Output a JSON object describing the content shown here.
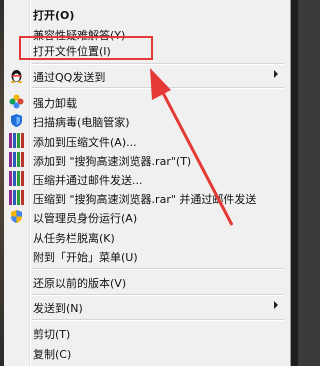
{
  "menu": {
    "items": [
      {
        "label": "打开(O)",
        "bold": true
      },
      {
        "label": "兼容性疑难解答(Y)"
      },
      {
        "label": "打开文件位置(I)"
      },
      {
        "label": "通过QQ发送到",
        "submenu": true,
        "icon": "qq-penguin-icon"
      },
      {
        "label": "强力卸载",
        "icon": "pinwheel-icon"
      },
      {
        "label": "扫描病毒(电脑管家)",
        "icon": "shield-icon"
      },
      {
        "label": "添加到压缩文件(A)...",
        "icon": "winrar-icon"
      },
      {
        "label": "添加到 \"搜狗高速浏览器.rar\"(T)",
        "icon": "winrar-icon"
      },
      {
        "label": "压缩并通过邮件发送...",
        "icon": "winrar-icon"
      },
      {
        "label": "压缩到 \"搜狗高速浏览器.rar\" 并通过邮件发送",
        "icon": "winrar-icon"
      },
      {
        "label": "以管理员身份运行(A)",
        "icon": "uac-shield-icon"
      },
      {
        "label": "从任务栏脱离(K)"
      },
      {
        "label": "附到「开始」菜单(U)"
      },
      {
        "label": "还原以前的版本(V)"
      },
      {
        "label": "发送到(N)",
        "submenu": true
      },
      {
        "label": "剪切(T)"
      },
      {
        "label": "复制(C)"
      }
    ]
  },
  "annotation": {
    "color": "#e53935"
  }
}
